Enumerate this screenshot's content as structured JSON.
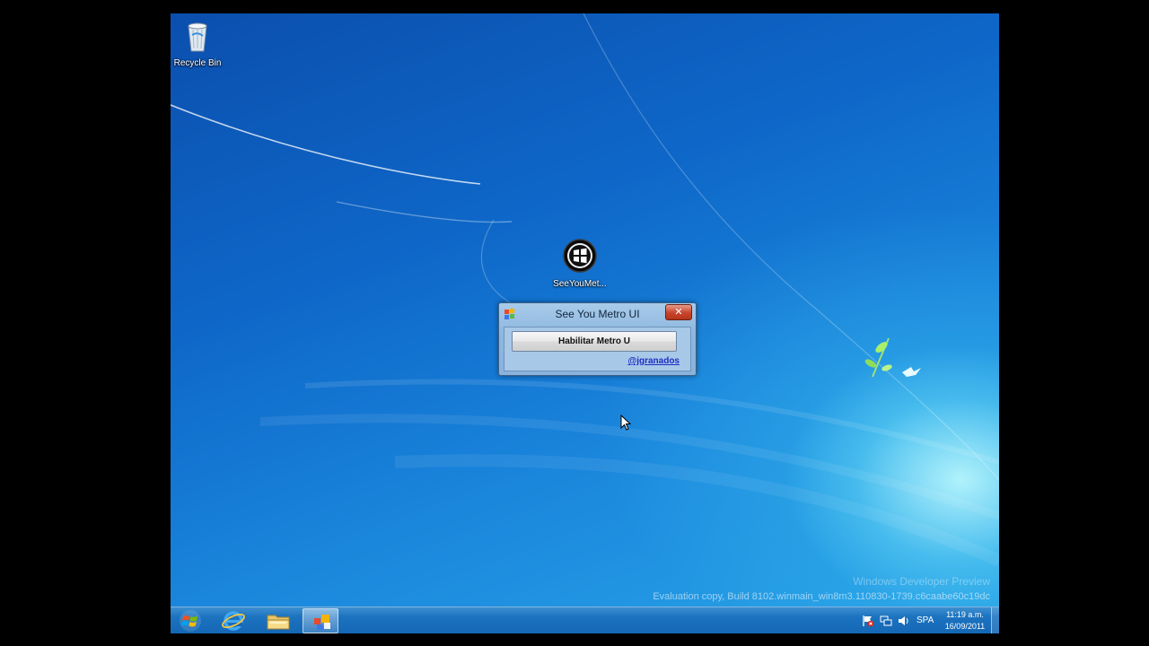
{
  "desktop": {
    "icons": [
      {
        "label": "Recycle Bin",
        "icon": "recycle-bin-icon"
      },
      {
        "label": "SeeYouMet...",
        "icon": "windows-logo-icon"
      }
    ]
  },
  "dialog": {
    "title": "See  You Metro UI",
    "close_label": "✕",
    "button_label": "Habilitar Metro U",
    "link_label": "@jgranados"
  },
  "watermark": {
    "edition": "Windows Developer Preview",
    "build": "Evaluation copy, Build 8102.winmain_win8m3.110830-1739.c6caabe60c19dc"
  },
  "taskbar": {
    "items": [
      "start-orb-icon",
      "internet-explorer-icon",
      "file-explorer-icon",
      "seeyoumetro-app-icon"
    ],
    "tray": {
      "language": "SPA",
      "time": "11:19 a.m.",
      "date": "16/09/2011"
    }
  },
  "colors": {
    "desktop_top": "#0b4fae",
    "desktop_glow": "#c8ffff",
    "taskbar": "#1466b5",
    "close_red": "#c8432a",
    "link_blue": "#1c2fc4"
  }
}
